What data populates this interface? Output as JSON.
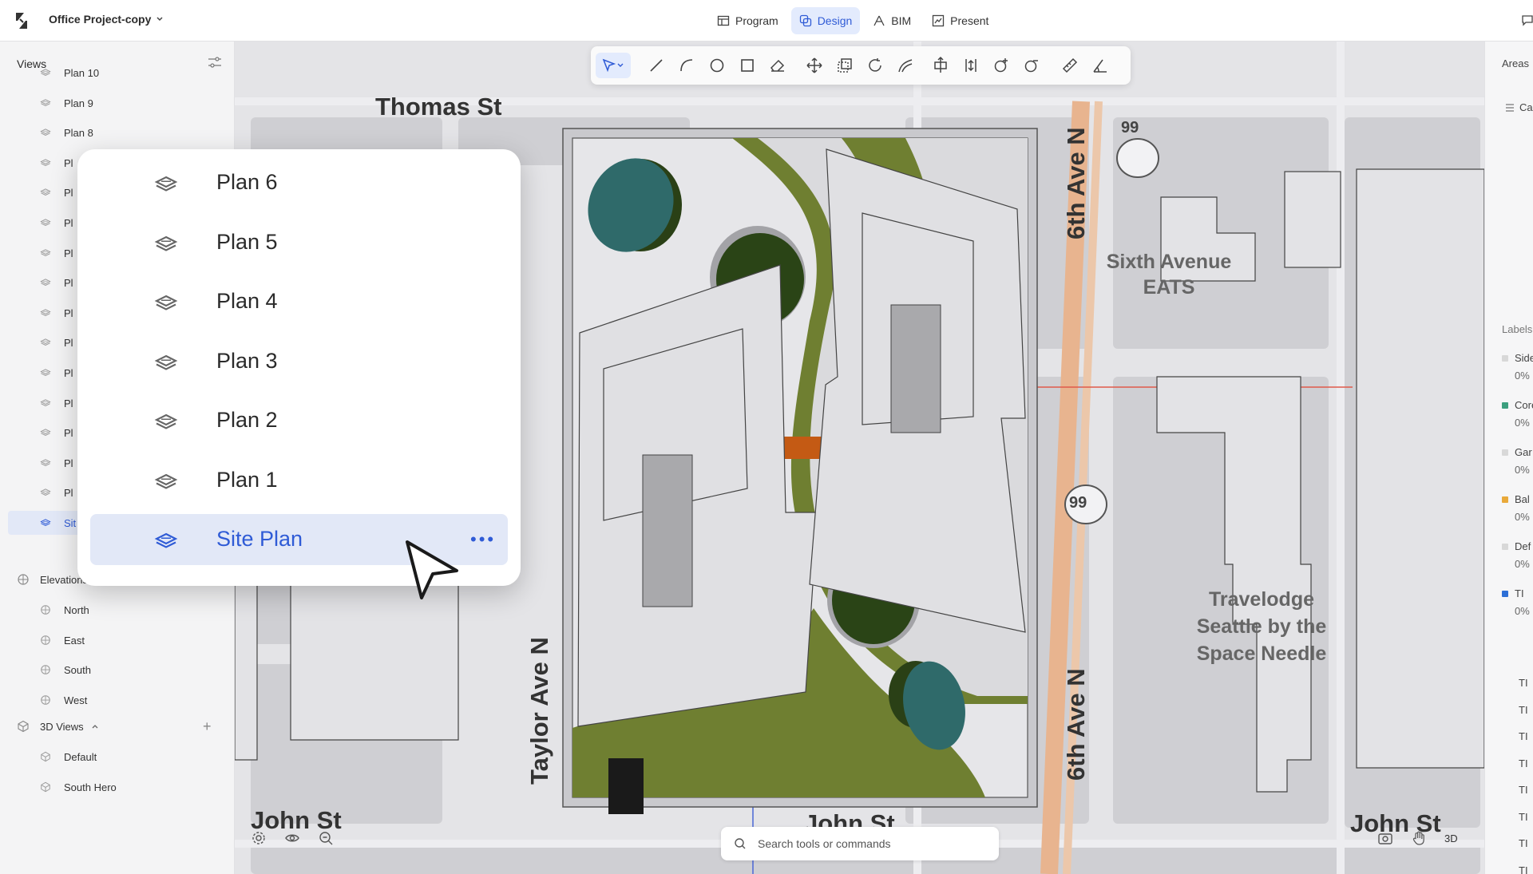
{
  "header": {
    "project_name": "Office Project-copy",
    "modes": [
      {
        "label": "Program",
        "icon": "table-icon"
      },
      {
        "label": "Design",
        "icon": "design-icon",
        "active": true
      },
      {
        "label": "BIM",
        "icon": "bim-icon"
      },
      {
        "label": "Present",
        "icon": "present-icon"
      }
    ]
  },
  "sidebar": {
    "title": "Views",
    "plans": [
      {
        "label": "Plan 10"
      },
      {
        "label": "Plan 9"
      },
      {
        "label": "Plan 8"
      },
      {
        "label": "Pl"
      },
      {
        "label": "Pl"
      },
      {
        "label": "Pl"
      },
      {
        "label": "Pl"
      },
      {
        "label": "Pl"
      },
      {
        "label": "Pl"
      },
      {
        "label": "Pl"
      },
      {
        "label": "Pl"
      },
      {
        "label": "Pl"
      },
      {
        "label": "Pl"
      },
      {
        "label": "Pl"
      },
      {
        "label": "Pl"
      },
      {
        "label": "Sit"
      }
    ],
    "elevations_label": "Elevations",
    "elevations": [
      {
        "label": "North"
      },
      {
        "label": "East"
      },
      {
        "label": "South"
      },
      {
        "label": "West"
      }
    ],
    "views3d_label": "3D Views",
    "views3d": [
      {
        "label": "Default"
      },
      {
        "label": "South Hero"
      }
    ]
  },
  "popup": {
    "items": [
      {
        "label": "Plan 6"
      },
      {
        "label": "Plan 5"
      },
      {
        "label": "Plan 4"
      },
      {
        "label": "Plan 3"
      },
      {
        "label": "Plan 2"
      },
      {
        "label": "Plan 1"
      },
      {
        "label": "Site Plan",
        "selected": true
      }
    ],
    "more_label": "•••"
  },
  "map": {
    "streets": {
      "thomas": "Thomas St",
      "sixth_top": "6th Ave N",
      "sixth_bottom": "6th Ave N",
      "taylor": "Taylor Ave N",
      "john_left": "John St",
      "john_center": "John St",
      "john_right": "John St"
    },
    "highway": "99",
    "poi_sixth_eats_1": "Sixth Avenue",
    "poi_sixth_eats_2": "EATS",
    "poi_travelodge_1": "Travelodge",
    "poi_travelodge_2": "Seattle by the",
    "poi_travelodge_3": "Space Needle"
  },
  "right_panel": {
    "tab": "Areas",
    "list_item": "Ca",
    "labels_title": "Labels",
    "entries": [
      {
        "name": "Side",
        "pct": "0%",
        "color": "#d8d8d8"
      },
      {
        "name": "Core",
        "pct": "0%",
        "color": "#3c9f7e"
      },
      {
        "name": "Gar",
        "pct": "0%",
        "color": "#d8d8d8"
      },
      {
        "name": "Bal",
        "pct": "0%",
        "color": "#e9a93a"
      },
      {
        "name": "Def",
        "pct": "0%",
        "color": "#d8d8d8"
      },
      {
        "name": "TI",
        "pct": "0%",
        "color": "#2d6fd6"
      }
    ],
    "ti_rows": [
      "TI",
      "TI",
      "TI",
      "TI",
      "TI",
      "TI",
      "TI",
      "TI",
      "TI"
    ]
  },
  "search": {
    "placeholder": "Search tools or commands"
  },
  "bottom": {
    "view_3d_label": "3D"
  },
  "colors": {
    "accent": "#2f5bd6",
    "accent_bg": "#e2e8f7",
    "landscape_green": "#6c7f2a",
    "tree_teal": "#2f6a6a",
    "dark_green": "#2b4418",
    "bridge_orange": "#c45a14"
  }
}
